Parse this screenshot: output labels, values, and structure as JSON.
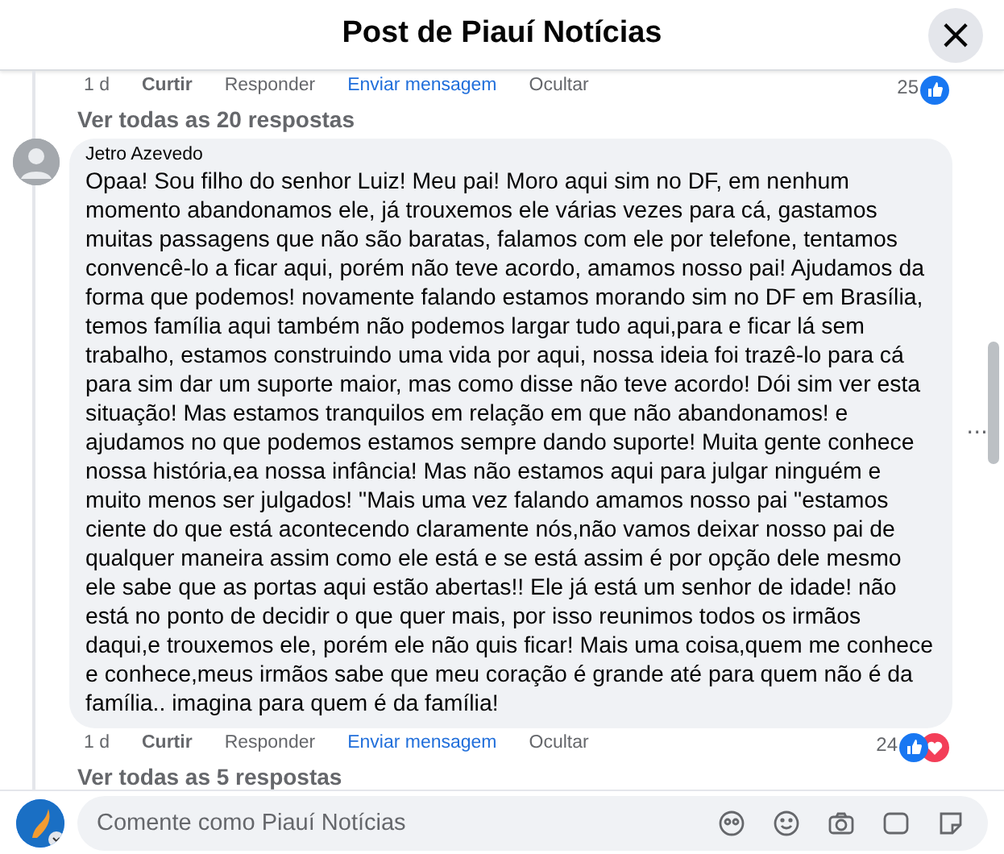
{
  "header": {
    "title": "Post de Piauí Notícias",
    "close": "×"
  },
  "thread": [
    {
      "kind": "actions",
      "time": "1 d",
      "like": "Curtir",
      "reply": "Responder",
      "message": "Enviar mensagem",
      "hide": "Ocultar",
      "count": "25",
      "reactions": [
        {
          "kind": "like"
        }
      ]
    },
    {
      "kind": "replies",
      "text": "Ver todas as 20 respostas"
    },
    {
      "kind": "comment",
      "author": "Jetro Azevedo",
      "text": "Opaa! Sou filho do senhor Luiz! Meu pai! Moro aqui sim no DF, em nenhum momento abandonamos ele, já trouxemos ele várias vezes para cá, gastamos muitas passagens que não são baratas, falamos com ele por telefone, tentamos convencê-lo a ficar aqui, porém não teve acordo, amamos nosso pai! Ajudamos da forma que podemos! novamente falando estamos morando sim no DF em Brasília, temos família aqui também não podemos largar tudo aqui,para e ficar lá sem trabalho, estamos construindo uma vida por aqui, nossa ideia foi trazê-lo para cá para sim dar um suporte maior, mas como disse não teve acordo! Dói sim ver esta situação! Mas estamos tranquilos em relação em que não abandonamos! e ajudamos no que podemos estamos sempre dando suporte! Muita gente conhece nossa história,ea nossa infância! Mas não estamos aqui para julgar ninguém e muito menos ser julgados! \"Mais uma vez falando amamos nosso pai \"estamos ciente do que está acontecendo claramente nós,não vamos deixar nosso pai de qualquer maneira assim como ele está e se está assim é por opção dele mesmo ele sabe que as portas aqui estão abertas!! Ele já está um senhor de idade! não está no ponto de decidir o que quer mais, por isso reunimos todos os irmãos daqui,e trouxemos ele, porém ele não quis ficar! Mais uma coisa,quem me conhece e conhece,meus irmãos sabe que meu coração é grande até para quem não é da família.. imagina para quem é da família!"
    },
    {
      "kind": "actions",
      "time": "1 d",
      "like": "Curtir",
      "reply": "Responder",
      "message": "Enviar mensagem",
      "hide": "Ocultar",
      "count": "24",
      "reactions": [
        {
          "kind": "like"
        },
        {
          "kind": "heart"
        }
      ]
    },
    {
      "kind": "replies",
      "text": "Ver todas as 5 respostas"
    }
  ],
  "more": "···",
  "composer": {
    "placeholder": "Comente como Piauí Notícias"
  }
}
